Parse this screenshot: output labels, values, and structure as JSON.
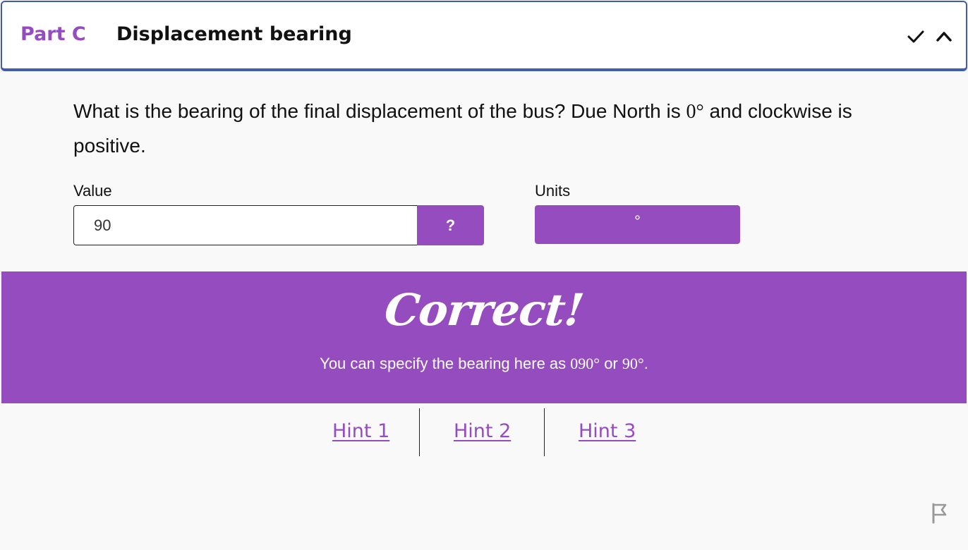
{
  "header": {
    "part_label": "Part C",
    "title": "Displacement bearing",
    "icons": [
      "check-icon",
      "chevron-up-icon"
    ]
  },
  "question": {
    "text_before": "What is the bearing of the final displacement of the bus? Due North is ",
    "math": "0°",
    "text_after": " and clockwise is positive."
  },
  "form": {
    "value_label": "Value",
    "value": "90",
    "help_button_label": "?",
    "units_label": "Units",
    "units_value": "°"
  },
  "feedback": {
    "title": "Correct!",
    "text_before": "You can specify the bearing here as ",
    "math1": "090°",
    "text_middle": " or ",
    "math2": "90°",
    "text_after": "."
  },
  "hints": [
    "Hint 1",
    "Hint 2",
    "Hint 3"
  ],
  "colors": {
    "accent": "#944cbe",
    "header_border": "#3f5cb0",
    "background": "#f9f9f9"
  },
  "footer": {
    "icons": [
      "flag-icon"
    ]
  }
}
